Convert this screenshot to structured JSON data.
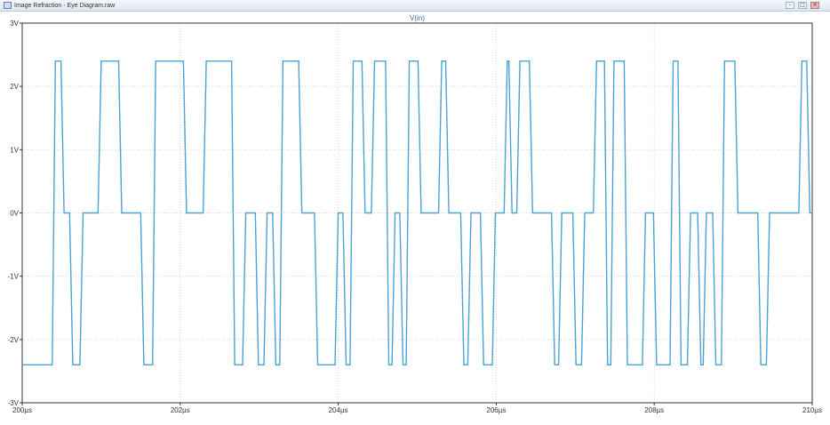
{
  "window": {
    "title": "Image Refraction - Eye Diagram.raw",
    "buttons": [
      "–",
      "□",
      "×"
    ]
  },
  "colors": {
    "trace": "#4aa3d4",
    "grid": "#d2d2d2",
    "frame": "#333333",
    "trace_title": "#2e74b5"
  },
  "chart_data": {
    "type": "line",
    "title": "V(in)",
    "xlabel": "",
    "ylabel": "",
    "xlim": [
      200,
      210
    ],
    "ylim": [
      -3,
      3
    ],
    "x_ticks": [
      200,
      202,
      204,
      206,
      208,
      210
    ],
    "x_tick_labels": [
      "200µs",
      "202µs",
      "204µs",
      "206µs",
      "208µs",
      "210µs"
    ],
    "y_ticks": [
      3,
      2,
      1,
      0,
      -1,
      -2,
      -3
    ],
    "y_tick_labels": [
      "3V",
      "2V",
      "1V",
      "0V",
      "-1V",
      "-2V",
      "-3V"
    ],
    "grid": true,
    "series": [
      {
        "name": "V(in)",
        "x": [
          200.0,
          200.38,
          200.42,
          200.49,
          200.53,
          200.6,
          200.64,
          200.73,
          200.77,
          200.96,
          201.0,
          201.22,
          201.26,
          201.5,
          201.54,
          201.65,
          201.69,
          202.04,
          202.08,
          202.29,
          202.33,
          202.65,
          202.69,
          202.79,
          202.83,
          202.95,
          202.99,
          203.06,
          203.1,
          203.17,
          203.21,
          203.26,
          203.3,
          203.5,
          203.54,
          203.7,
          203.74,
          203.96,
          204.0,
          204.06,
          204.1,
          204.15,
          204.19,
          204.3,
          204.34,
          204.42,
          204.46,
          204.6,
          204.64,
          204.68,
          204.72,
          204.78,
          204.82,
          204.86,
          204.9,
          205.01,
          205.05,
          205.27,
          205.31,
          205.36,
          205.4,
          205.55,
          205.59,
          205.64,
          205.68,
          205.8,
          205.84,
          205.95,
          205.99,
          206.1,
          206.14,
          206.16,
          206.2,
          206.26,
          206.3,
          206.42,
          206.46,
          206.7,
          206.74,
          206.79,
          206.83,
          206.97,
          207.01,
          207.08,
          207.12,
          207.23,
          207.27,
          207.37,
          207.41,
          207.45,
          207.49,
          207.62,
          207.66,
          207.85,
          207.89,
          207.99,
          208.03,
          208.2,
          208.24,
          208.3,
          208.34,
          208.42,
          208.46,
          208.55,
          208.59,
          208.62,
          208.66,
          208.74,
          208.78,
          208.85,
          208.89,
          209.02,
          209.06,
          209.31,
          209.35,
          209.42,
          209.46,
          209.83,
          209.87,
          209.93,
          209.97,
          210.0
        ],
        "y": [
          -2.4,
          -2.4,
          2.4,
          2.4,
          0,
          0,
          -2.4,
          -2.4,
          0,
          0,
          2.4,
          2.4,
          0,
          0,
          -2.4,
          -2.4,
          2.4,
          2.4,
          0,
          0,
          2.4,
          2.4,
          -2.4,
          -2.4,
          0,
          0,
          -2.4,
          -2.4,
          0,
          0,
          -2.4,
          -2.4,
          2.4,
          2.4,
          0,
          0,
          -2.4,
          -2.4,
          0,
          0,
          -2.4,
          -2.4,
          2.4,
          2.4,
          0,
          0,
          2.4,
          2.4,
          -2.4,
          -2.4,
          0,
          0,
          -2.4,
          -2.4,
          2.4,
          2.4,
          0,
          0,
          2.4,
          2.4,
          0,
          0,
          -2.4,
          -2.4,
          0,
          0,
          -2.4,
          -2.4,
          0,
          0,
          2.4,
          2.4,
          0,
          0,
          2.4,
          2.4,
          0,
          0,
          -2.4,
          -2.4,
          0,
          0,
          -2.4,
          -2.4,
          0,
          0,
          2.4,
          2.4,
          -2.4,
          -2.4,
          2.4,
          2.4,
          -2.4,
          -2.4,
          0,
          0,
          -2.4,
          -2.4,
          2.4,
          2.4,
          -2.4,
          -2.4,
          0,
          0,
          -2.4,
          -2.4,
          0,
          0,
          -2.4,
          -2.4,
          2.4,
          2.4,
          0,
          0,
          -2.4,
          -2.4,
          0,
          0,
          2.4,
          2.4,
          0,
          0
        ]
      }
    ]
  }
}
